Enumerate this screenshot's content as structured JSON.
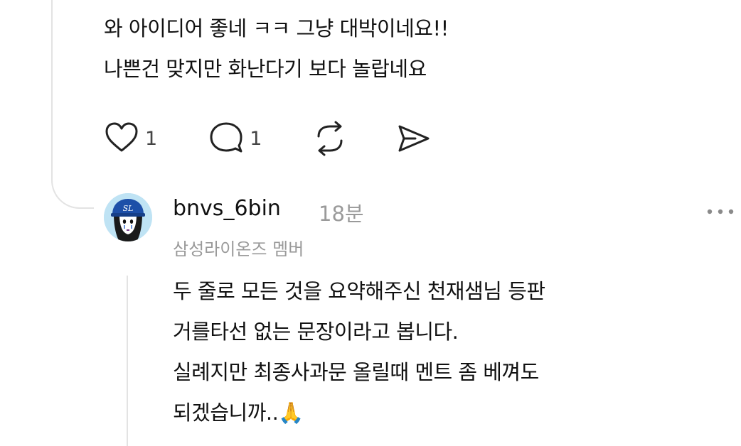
{
  "comment": {
    "lines": [
      "와 아이디어 좋네 ㅋㅋ 그냥 대박이네요!!",
      "나쁜건 맞지만 화난다기 보다 놀랍네요"
    ],
    "like_count": "1",
    "reply_count": "1",
    "icons": [
      "heart-icon",
      "comment-icon",
      "repost-icon",
      "share-icon"
    ]
  },
  "reply": {
    "username": "bnvs_6bin",
    "time": "18분",
    "badge": "삼성라이온즈 멤버",
    "lines": [
      "두 줄로 모든 것을 요약해주신 천재샘님 등판",
      "거를타선 없는 문장이라고 봅니다.",
      "실례지만 최종사과문 올릴때 멘트 좀 베껴도",
      "되겠습니까..🙏"
    ],
    "avatar_text": "SL",
    "icons": [
      "avatar",
      "more-options-icon"
    ]
  },
  "colors": {
    "text": "#111111",
    "muted": "#9a9a9a",
    "thread_line": "#e3e3e3",
    "avatar_bg": "#bfe3f4",
    "cap": "#1d4fa8"
  }
}
